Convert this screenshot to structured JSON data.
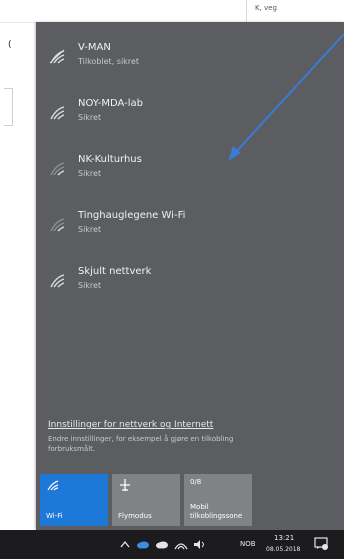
{
  "background": {
    "top_right_label": "K, veg",
    "left_fragment": "("
  },
  "networks": [
    {
      "name": "V-MAN",
      "status": "Tilkoblet, sikret"
    },
    {
      "name": "NOY-MDA-lab",
      "status": "Sikret"
    },
    {
      "name": "NK-Kulturhus",
      "status": "Sikret"
    },
    {
      "name": "Tinghauglegene Wi-Fi",
      "status": "Sikret"
    },
    {
      "name": "Skjult nettverk",
      "status": "Sikret"
    }
  ],
  "settings": {
    "link": "Innstillinger for nettverk og Internett",
    "description": "Endre innstillinger, for eksempel å gjøre en tilkobling forbruksmålt."
  },
  "tiles": {
    "wifi": "Wi-Fi",
    "airplane": "Flymodus",
    "hotspot_count": "0/8",
    "hotspot": "Mobil tilkoblingssone"
  },
  "taskbar": {
    "language": "NOB",
    "time": "13:21",
    "date": "08.05.2018"
  },
  "colors": {
    "flyout_bg": "#5b5d60",
    "accent": "#1d78d8",
    "taskbar_bg": "#1c1c1f",
    "annotation_arrow": "#3a7bd5"
  },
  "icons": [
    "wifi-icon",
    "airplane-icon",
    "hotspot-icon",
    "chevron-up-icon",
    "onedrive-icon",
    "network-icon",
    "volume-icon",
    "notifications-icon"
  ]
}
